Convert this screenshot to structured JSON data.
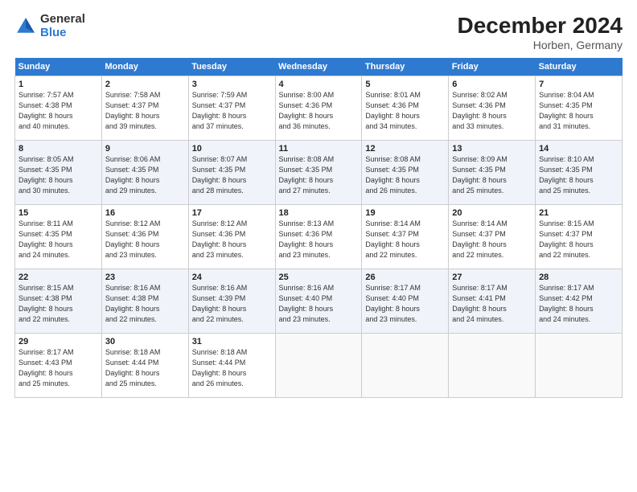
{
  "logo": {
    "general": "General",
    "blue": "Blue"
  },
  "title": "December 2024",
  "subtitle": "Horben, Germany",
  "days": [
    "Sunday",
    "Monday",
    "Tuesday",
    "Wednesday",
    "Thursday",
    "Friday",
    "Saturday"
  ],
  "weeks": [
    [
      {
        "day": "1",
        "sunrise": "7:57 AM",
        "sunset": "4:38 PM",
        "daylight": "8 hours and 40 minutes."
      },
      {
        "day": "2",
        "sunrise": "7:58 AM",
        "sunset": "4:37 PM",
        "daylight": "8 hours and 39 minutes."
      },
      {
        "day": "3",
        "sunrise": "7:59 AM",
        "sunset": "4:37 PM",
        "daylight": "8 hours and 37 minutes."
      },
      {
        "day": "4",
        "sunrise": "8:00 AM",
        "sunset": "4:36 PM",
        "daylight": "8 hours and 36 minutes."
      },
      {
        "day": "5",
        "sunrise": "8:01 AM",
        "sunset": "4:36 PM",
        "daylight": "8 hours and 34 minutes."
      },
      {
        "day": "6",
        "sunrise": "8:02 AM",
        "sunset": "4:36 PM",
        "daylight": "8 hours and 33 minutes."
      },
      {
        "day": "7",
        "sunrise": "8:04 AM",
        "sunset": "4:35 PM",
        "daylight": "8 hours and 31 minutes."
      }
    ],
    [
      {
        "day": "8",
        "sunrise": "8:05 AM",
        "sunset": "4:35 PM",
        "daylight": "8 hours and 30 minutes."
      },
      {
        "day": "9",
        "sunrise": "8:06 AM",
        "sunset": "4:35 PM",
        "daylight": "8 hours and 29 minutes."
      },
      {
        "day": "10",
        "sunrise": "8:07 AM",
        "sunset": "4:35 PM",
        "daylight": "8 hours and 28 minutes."
      },
      {
        "day": "11",
        "sunrise": "8:08 AM",
        "sunset": "4:35 PM",
        "daylight": "8 hours and 27 minutes."
      },
      {
        "day": "12",
        "sunrise": "8:08 AM",
        "sunset": "4:35 PM",
        "daylight": "8 hours and 26 minutes."
      },
      {
        "day": "13",
        "sunrise": "8:09 AM",
        "sunset": "4:35 PM",
        "daylight": "8 hours and 25 minutes."
      },
      {
        "day": "14",
        "sunrise": "8:10 AM",
        "sunset": "4:35 PM",
        "daylight": "8 hours and 25 minutes."
      }
    ],
    [
      {
        "day": "15",
        "sunrise": "8:11 AM",
        "sunset": "4:35 PM",
        "daylight": "8 hours and 24 minutes."
      },
      {
        "day": "16",
        "sunrise": "8:12 AM",
        "sunset": "4:36 PM",
        "daylight": "8 hours and 23 minutes."
      },
      {
        "day": "17",
        "sunrise": "8:12 AM",
        "sunset": "4:36 PM",
        "daylight": "8 hours and 23 minutes."
      },
      {
        "day": "18",
        "sunrise": "8:13 AM",
        "sunset": "4:36 PM",
        "daylight": "8 hours and 23 minutes."
      },
      {
        "day": "19",
        "sunrise": "8:14 AM",
        "sunset": "4:37 PM",
        "daylight": "8 hours and 22 minutes."
      },
      {
        "day": "20",
        "sunrise": "8:14 AM",
        "sunset": "4:37 PM",
        "daylight": "8 hours and 22 minutes."
      },
      {
        "day": "21",
        "sunrise": "8:15 AM",
        "sunset": "4:37 PM",
        "daylight": "8 hours and 22 minutes."
      }
    ],
    [
      {
        "day": "22",
        "sunrise": "8:15 AM",
        "sunset": "4:38 PM",
        "daylight": "8 hours and 22 minutes."
      },
      {
        "day": "23",
        "sunrise": "8:16 AM",
        "sunset": "4:38 PM",
        "daylight": "8 hours and 22 minutes."
      },
      {
        "day": "24",
        "sunrise": "8:16 AM",
        "sunset": "4:39 PM",
        "daylight": "8 hours and 22 minutes."
      },
      {
        "day": "25",
        "sunrise": "8:16 AM",
        "sunset": "4:40 PM",
        "daylight": "8 hours and 23 minutes."
      },
      {
        "day": "26",
        "sunrise": "8:17 AM",
        "sunset": "4:40 PM",
        "daylight": "8 hours and 23 minutes."
      },
      {
        "day": "27",
        "sunrise": "8:17 AM",
        "sunset": "4:41 PM",
        "daylight": "8 hours and 24 minutes."
      },
      {
        "day": "28",
        "sunrise": "8:17 AM",
        "sunset": "4:42 PM",
        "daylight": "8 hours and 24 minutes."
      }
    ],
    [
      {
        "day": "29",
        "sunrise": "8:17 AM",
        "sunset": "4:43 PM",
        "daylight": "8 hours and 25 minutes."
      },
      {
        "day": "30",
        "sunrise": "8:18 AM",
        "sunset": "4:44 PM",
        "daylight": "8 hours and 25 minutes."
      },
      {
        "day": "31",
        "sunrise": "8:18 AM",
        "sunset": "4:44 PM",
        "daylight": "8 hours and 26 minutes."
      },
      null,
      null,
      null,
      null
    ]
  ]
}
